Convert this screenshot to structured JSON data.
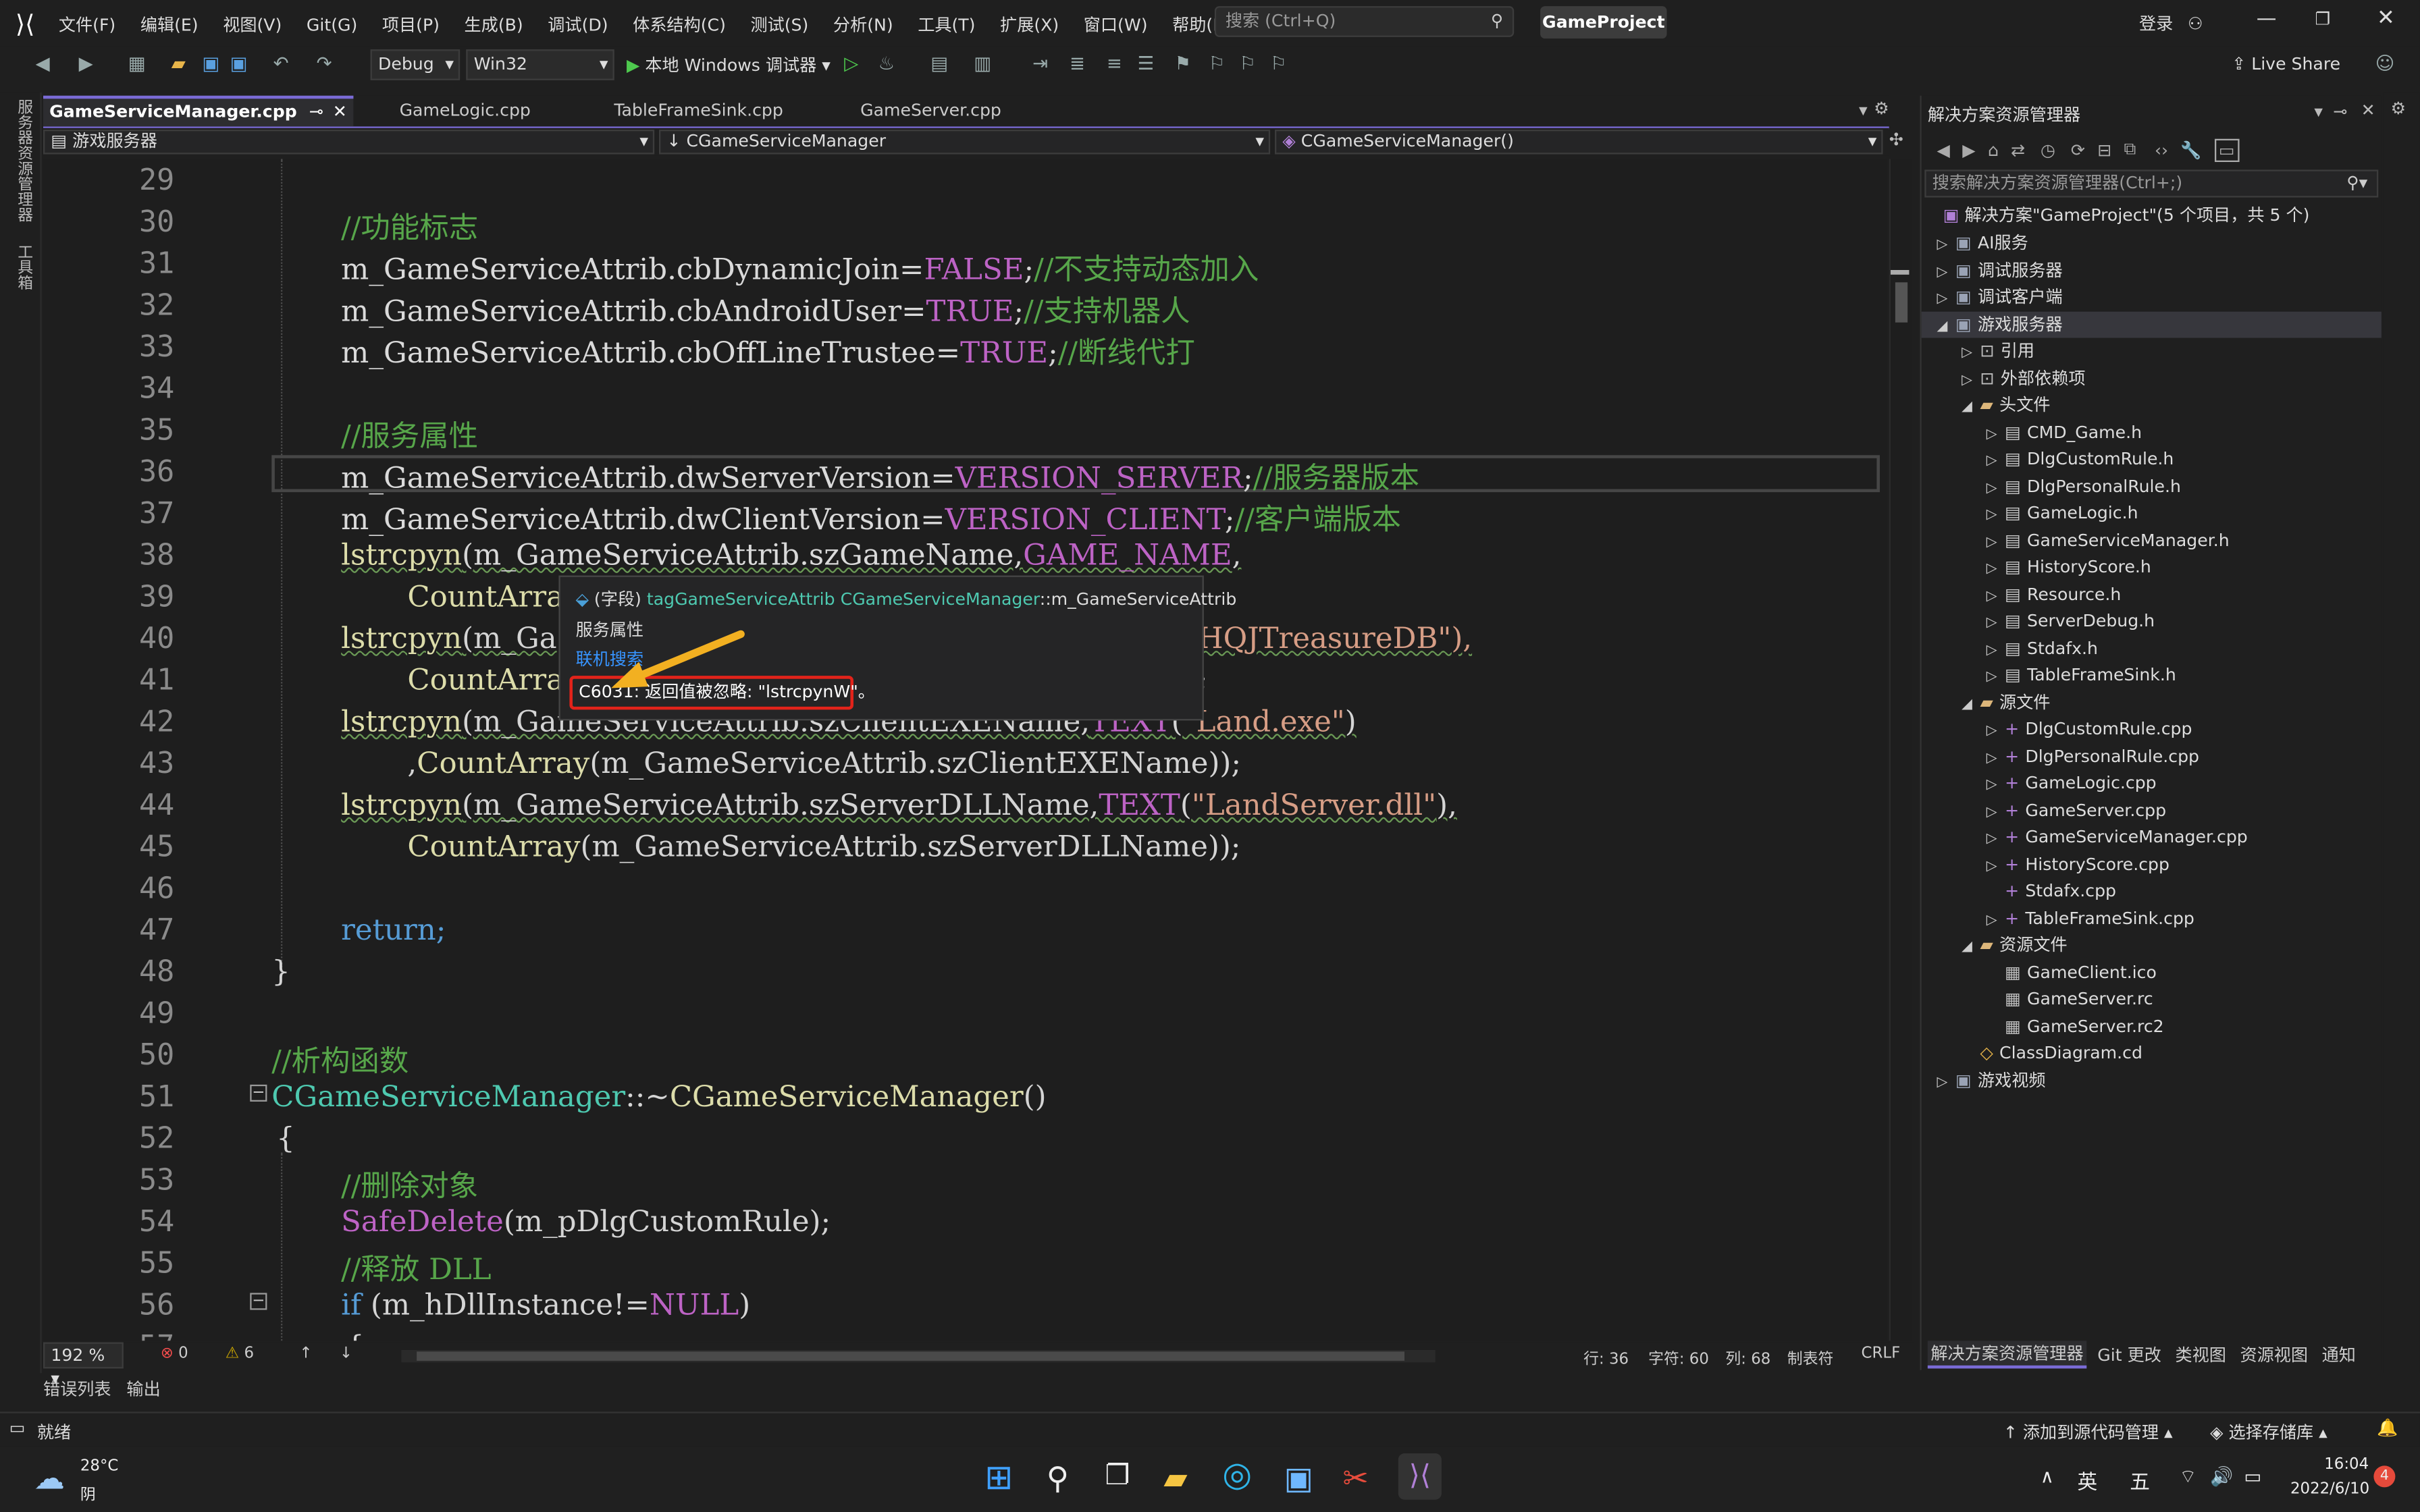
{
  "menu": [
    "文件(F)",
    "编辑(E)",
    "视图(V)",
    "Git(G)",
    "项目(P)",
    "生成(B)",
    "调试(D)",
    "体系结构(C)",
    "测试(S)",
    "分析(N)",
    "工具(T)",
    "扩展(X)",
    "窗口(W)",
    "帮助(H)"
  ],
  "search": {
    "placeholder": "搜索 (Ctrl+Q)"
  },
  "project_name": "GameProject",
  "login": "登录",
  "live_share": "Live Share",
  "toolbar": {
    "config": "Debug",
    "platform": "Win32",
    "run_label": "本地 Windows 调试器"
  },
  "left_strip": [
    "服务器资源管理器",
    "工具箱"
  ],
  "tabs": [
    {
      "label": "GameServiceManager.cpp",
      "active": true
    },
    {
      "label": "GameLogic.cpp"
    },
    {
      "label": "TableFrameSink.cpp"
    },
    {
      "label": "GameServer.cpp"
    }
  ],
  "navbar": {
    "project": "游戏服务器",
    "scope": "CGameServiceManager",
    "member": "CGameServiceManager()"
  },
  "code_lines": [
    {
      "n": "29",
      "text": ""
    },
    {
      "n": "30",
      "text": "//功能标志"
    },
    {
      "n": "31",
      "text": "m_GameServiceAttrib.cbDynamicJoin=FALSE;//不支持动态加入"
    },
    {
      "n": "32",
      "text": "m_GameServiceAttrib.cbAndroidUser=TRUE;//支持机器人"
    },
    {
      "n": "33",
      "text": "m_GameServiceAttrib.cbOffLineTrustee=TRUE;//断线代打"
    },
    {
      "n": "34",
      "text": ""
    },
    {
      "n": "35",
      "text": "//服务属性"
    },
    {
      "n": "36",
      "text": "m_GameServiceAttrib.dwServerVersion=VERSION_SERVER;//服务器版本"
    },
    {
      "n": "37",
      "text": "m_GameServiceAttrib.dwClientVersion=VERSION_CLIENT;//客户端版本"
    },
    {
      "n": "38",
      "text": "lstrcpyn(m_GameServiceAttrib.szGameName,GAME_NAME,"
    },
    {
      "n": "39",
      "text": "CountArray"
    },
    {
      "n": "40",
      "text": "lstrcpyn(m_Ga"
    },
    {
      "n": "41",
      "text": "CountArray"
    },
    {
      "n": "42",
      "text": "lstrcpyn(m_GameServiceAttrib.szClientEXEName,TEXT(\"Land.exe\")"
    },
    {
      "n": "43",
      "text": ",CountArray(m_GameServiceAttrib.szClientEXEName));"
    },
    {
      "n": "44",
      "text": "lstrcpyn(m_GameServiceAttrib.szServerDLLName,TEXT(\"LandServer.dll\"),"
    },
    {
      "n": "45",
      "text": "CountArray(m_GameServiceAttrib.szServerDLLName));"
    },
    {
      "n": "46",
      "text": ""
    },
    {
      "n": "47",
      "text": "return;"
    },
    {
      "n": "48",
      "text": "}"
    },
    {
      "n": "49",
      "text": ""
    },
    {
      "n": "50",
      "text": "//析构函数"
    },
    {
      "n": "51",
      "text": "CGameServiceManager::~CGameServiceManager()"
    },
    {
      "n": "52",
      "text": "{"
    },
    {
      "n": "53",
      "text": "//删除对象"
    },
    {
      "n": "54",
      "text": "SafeDelete(m_pDlgCustomRule);"
    },
    {
      "n": "55",
      "text": "//释放 DLL"
    },
    {
      "n": "56",
      "text": "if (m_hDllInstance!=NULL)"
    },
    {
      "n": "57",
      "text": "{"
    }
  ],
  "code_fragments": {
    "line40_tail": "HQJTreasureDB\"),",
    "line41_tail": ";"
  },
  "tooltip": {
    "kind": "(字段)",
    "type": "tagGameServiceAttrib",
    "owner": "CGameServiceManager",
    "member": "::m_GameServiceAttrib",
    "desc": "服务属性",
    "link": "联机搜索",
    "warning": "C6031: 返回值被忽略: \"lstrcpynW\"。"
  },
  "editor_status": {
    "zoom": "192 %",
    "errors": "0",
    "warnings": "6",
    "line": "行: 36",
    "char": "字符: 60",
    "col": "列: 68",
    "tab": "制表符",
    "eol": "CRLF"
  },
  "bottom_tabs": [
    "错误列表",
    "输出"
  ],
  "statusbar": {
    "ready": "就绪",
    "add_source": "添加到源代码管理",
    "select_repo": "选择存储库"
  },
  "solution_explorer": {
    "title": "解决方案资源管理器",
    "search_placeholder": "搜索解决方案资源管理器(Ctrl+;)",
    "root": "解决方案\"GameProject\"(5 个项目，共 5 个)",
    "items": [
      {
        "label": "AI服务",
        "level": 1,
        "kind": "proj",
        "arrow": "▷"
      },
      {
        "label": "调试服务器",
        "level": 1,
        "kind": "proj",
        "arrow": "▷"
      },
      {
        "label": "调试客户端",
        "level": 1,
        "kind": "proj",
        "arrow": "▷"
      },
      {
        "label": "游戏服务器",
        "level": 1,
        "kind": "proj",
        "arrow": "◢",
        "selected": true
      },
      {
        "label": "引用",
        "level": 2,
        "kind": "ref",
        "arrow": "▷"
      },
      {
        "label": "外部依赖项",
        "level": 2,
        "kind": "ref",
        "arrow": "▷"
      },
      {
        "label": "头文件",
        "level": 2,
        "kind": "folder",
        "arrow": "◢"
      },
      {
        "label": "CMD_Game.h",
        "level": 3,
        "kind": "h",
        "arrow": "▷"
      },
      {
        "label": "DlgCustomRule.h",
        "level": 3,
        "kind": "h",
        "arrow": "▷"
      },
      {
        "label": "DlgPersonalRule.h",
        "level": 3,
        "kind": "h",
        "arrow": "▷"
      },
      {
        "label": "GameLogic.h",
        "level": 3,
        "kind": "h",
        "arrow": "▷"
      },
      {
        "label": "GameServiceManager.h",
        "level": 3,
        "kind": "h",
        "arrow": "▷"
      },
      {
        "label": "HistoryScore.h",
        "level": 3,
        "kind": "h",
        "arrow": "▷"
      },
      {
        "label": "Resource.h",
        "level": 3,
        "kind": "h",
        "arrow": "▷"
      },
      {
        "label": "ServerDebug.h",
        "level": 3,
        "kind": "h",
        "arrow": "▷"
      },
      {
        "label": "Stdafx.h",
        "level": 3,
        "kind": "h",
        "arrow": "▷"
      },
      {
        "label": "TableFrameSink.h",
        "level": 3,
        "kind": "h",
        "arrow": "▷"
      },
      {
        "label": "源文件",
        "level": 2,
        "kind": "folder",
        "arrow": "◢"
      },
      {
        "label": "DlgCustomRule.cpp",
        "level": 3,
        "kind": "cpp",
        "arrow": "▷"
      },
      {
        "label": "DlgPersonalRule.cpp",
        "level": 3,
        "kind": "cpp",
        "arrow": "▷"
      },
      {
        "label": "GameLogic.cpp",
        "level": 3,
        "kind": "cpp",
        "arrow": "▷"
      },
      {
        "label": "GameServer.cpp",
        "level": 3,
        "kind": "cpp",
        "arrow": "▷"
      },
      {
        "label": "GameServiceManager.cpp",
        "level": 3,
        "kind": "cpp",
        "arrow": "▷"
      },
      {
        "label": "HistoryScore.cpp",
        "level": 3,
        "kind": "cpp",
        "arrow": "▷"
      },
      {
        "label": "Stdafx.cpp",
        "level": 3,
        "kind": "cpp",
        "arrow": ""
      },
      {
        "label": "TableFrameSink.cpp",
        "level": 3,
        "kind": "cpp",
        "arrow": "▷"
      },
      {
        "label": "资源文件",
        "level": 2,
        "kind": "folder",
        "arrow": "◢"
      },
      {
        "label": "GameClient.ico",
        "level": 3,
        "kind": "res",
        "arrow": ""
      },
      {
        "label": "GameServer.rc",
        "level": 3,
        "kind": "res",
        "arrow": ""
      },
      {
        "label": "GameServer.rc2",
        "level": 3,
        "kind": "res",
        "arrow": ""
      },
      {
        "label": "ClassDiagram.cd",
        "level": 2,
        "kind": "cd",
        "arrow": ""
      },
      {
        "label": "游戏视频",
        "level": 1,
        "kind": "proj",
        "arrow": "▷"
      }
    ],
    "bottom_tabs": [
      "解决方案资源管理器",
      "Git 更改",
      "类视图",
      "资源视图",
      "通知"
    ]
  },
  "taskbar": {
    "temp": "28°C",
    "weather": "阴",
    "ime1": "英",
    "ime2": "五",
    "time": "16:04",
    "date": "2022/6/10",
    "badge": "4"
  },
  "colors": {
    "accent": "#7a6bd6",
    "error_box": "#e2231a",
    "comment": "#57a64a",
    "macro": "#bd63c5",
    "keyword": "#569cd6"
  }
}
